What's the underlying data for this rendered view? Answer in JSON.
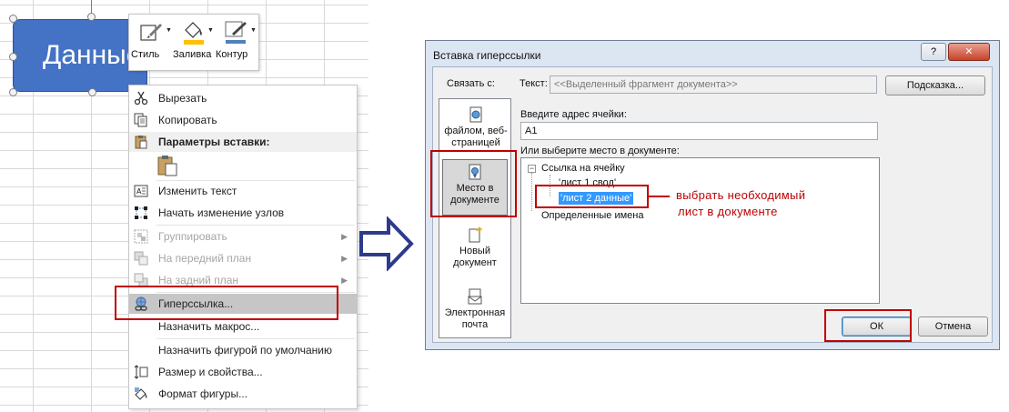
{
  "shape": {
    "text": "Данные"
  },
  "mini_toolbar": {
    "style_label": "Стиль",
    "fill_label": "Заливка",
    "outline_label": "Контур"
  },
  "context_menu": {
    "cut": "Вырезать",
    "copy": "Копировать",
    "paste_options": "Параметры вставки:",
    "edit_text": "Изменить текст",
    "edit_points": "Начать изменение узлов",
    "group": "Группировать",
    "bring_forward": "На передний план",
    "send_backward": "На задний план",
    "hyperlink": "Гиперссылка...",
    "assign_macro": "Назначить макрос...",
    "set_default": "Назначить фигурой по умолчанию",
    "size_properties": "Размер и свойства...",
    "format_shape": "Формат фигуры..."
  },
  "dialog": {
    "title": "Вставка гиперссылки",
    "help_glyph": "?",
    "close_glyph": "✕",
    "link_to_label": "Связать с:",
    "text_label": "Текст:",
    "text_value": "<<Выделенный фрагмент документа>>",
    "screentip_button": "Подсказка...",
    "link_types": [
      {
        "label": "файлом, веб-страницей"
      },
      {
        "label": "Место в документе"
      },
      {
        "label": "Новый документ"
      },
      {
        "label": "Электронная почта"
      }
    ],
    "cell_ref_label": "Введите адрес ячейки:",
    "cell_ref_value": "A1",
    "place_label": "Или выберите место в документе:",
    "tree": {
      "cell_reference": "Ссылка на ячейку",
      "sheet1": "'лист 1 свод'",
      "sheet2": "'лист 2 данные'",
      "defined_names": "Определенные имена"
    },
    "ok_button": "ОК",
    "cancel_button": "Отмена"
  },
  "annotation": {
    "line1": "выбрать необходимый",
    "line2": "лист в документе"
  },
  "colors": {
    "accent_red": "#c00000",
    "shape_blue": "#4472c4",
    "arrow_blue": "#2e3a8c",
    "selection_blue": "#3399ff"
  }
}
